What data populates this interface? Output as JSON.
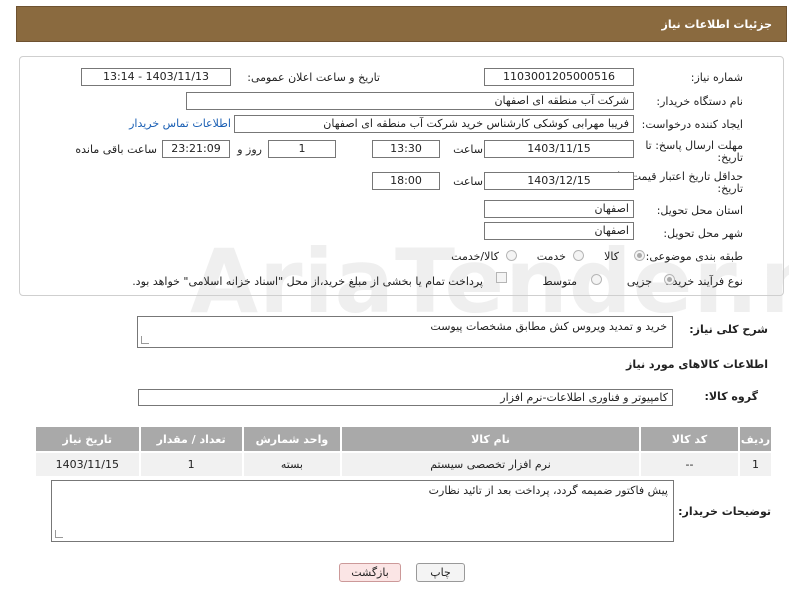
{
  "header": {
    "title": "جزئیات اطلاعات نیاز"
  },
  "form": {
    "need_number": {
      "label": "شماره نیاز:",
      "value": "1103001205000516"
    },
    "announce_datetime": {
      "label": "تاریخ و ساعت اعلان عمومی:",
      "value": "1403/11/13 - 13:14"
    },
    "buyer_org": {
      "label": "نام دستگاه خریدار:",
      "value": "شرکت آب منطقه ای اصفهان"
    },
    "requester": {
      "label": "ایجاد کننده درخواست:",
      "value": "فریبا مهرابی کوشکی کارشناس خرید شرکت آب منطقه ای اصفهان",
      "contact_link": "اطلاعات تماس خریدار"
    },
    "reply_deadline": {
      "label": "مهلت ارسال پاسخ: تا",
      "label2": "تاریخ:",
      "date": "1403/11/15",
      "time_label": "ساعت",
      "time": "13:30",
      "days": "1",
      "days_label": "روز و",
      "remaining": "23:21:09",
      "remaining_label": "ساعت باقی مانده"
    },
    "price_validity": {
      "label": "حداقل تاریخ اعتبار قیمت: تا",
      "label2": "تاریخ:",
      "date": "1403/12/15",
      "time_label": "ساعت",
      "time": "18:00"
    },
    "province": {
      "label": "استان محل تحویل:",
      "value": "اصفهان"
    },
    "city": {
      "label": "شهر محل تحویل:",
      "value": "اصفهان"
    },
    "category": {
      "label": "طبقه بندی موضوعی:",
      "options": [
        "کالا",
        "خدمت",
        "کالا/خدمت"
      ],
      "selected": "کالا"
    },
    "process": {
      "label": "نوع فرآیند خرید :",
      "options": [
        "جزیی",
        "متوسط"
      ],
      "selected": "جزیی",
      "payment_note": "پرداخت تمام یا بخشی از مبلغ خرید،از محل \"اسناد خزانه اسلامی\" خواهد بود."
    }
  },
  "description": {
    "label": "شرح کلی نیاز:",
    "value": "خرید و تمدید ویروس کش مطابق مشخصات پیوست"
  },
  "goods_section": {
    "title": "اطلاعات کالاهای مورد نیاز",
    "group_label": "گروه کالا:",
    "group_value": "کامپیوتر و فناوری اطلاعات-نرم افزار"
  },
  "table": {
    "headers": [
      "ردیف",
      "کد کالا",
      "نام کالا",
      "واحد شمارش",
      "تعداد / مقدار",
      "تاریخ نیاز"
    ],
    "rows": [
      [
        "1",
        "--",
        "نرم افزار تخصصی سیستم",
        "بسته",
        "1",
        "1403/11/15"
      ]
    ]
  },
  "buyer_notes": {
    "label": "توضیحات خریدار:",
    "value": "پیش فاکتور ضمیمه گردد، پرداخت بعد از تائید نظارت"
  },
  "buttons": {
    "print": "چاپ",
    "back": "بازگشت"
  },
  "watermark": "AriaTender.neT"
}
